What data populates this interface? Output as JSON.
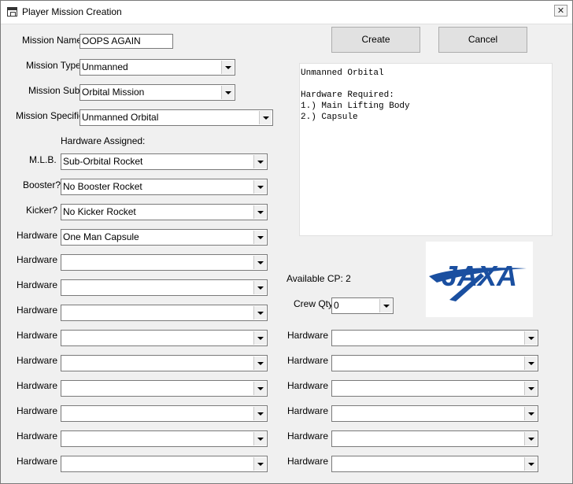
{
  "window": {
    "title": "Player Mission Creation",
    "close_glyph": "✕"
  },
  "form": {
    "mission_name_label": "Mission Name:",
    "mission_name_value": "OOPS AGAIN",
    "mission_type_label": "Mission Type:",
    "mission_type_value": "Unmanned",
    "mission_sub_label": "Mission Sub:",
    "mission_sub_value": "Orbital Mission",
    "mission_specific_label": "Mission Specific:",
    "mission_specific_value": "Unmanned Orbital",
    "hardware_assigned_label": "Hardware Assigned:",
    "mlb_label": "M.L.B.",
    "mlb_value": "Sub-Orbital Rocket",
    "booster_label": "Booster?",
    "booster_value": "No Booster Rocket",
    "kicker_label": "Kicker?",
    "kicker_value": "No Kicker Rocket",
    "hardware_label": "Hardware",
    "hardware_left": [
      "One Man Capsule",
      "",
      "",
      "",
      "",
      "",
      "",
      "",
      "",
      ""
    ],
    "hardware_right": [
      "",
      "",
      "",
      "",
      "",
      ""
    ],
    "available_cp": "Available CP: 2",
    "crew_qty_label": "Crew Qty",
    "crew_qty_value": "0"
  },
  "buttons": {
    "create": "Create",
    "cancel": "Cancel"
  },
  "info": {
    "text": "Unmanned Orbital\n\nHardware Required:\n1.) Main Lifting Body\n2.) Capsule"
  },
  "logo": {
    "text": "JAXA",
    "color": "#1a4fa0"
  }
}
